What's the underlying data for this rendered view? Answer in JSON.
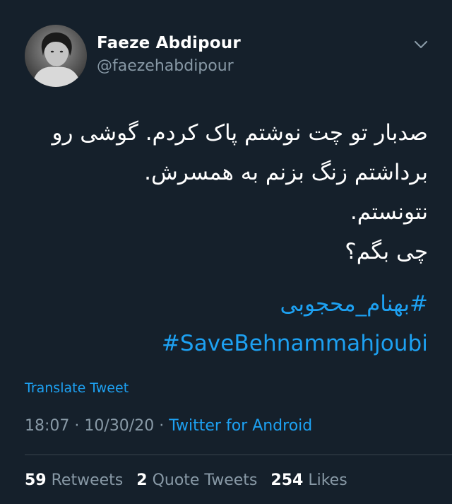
{
  "author": {
    "name": "Faeze Abdipour",
    "handle": "@faezehabdipour"
  },
  "tweet": {
    "lines": [
      "صدبار تو چت نوشتم پاک کردم. گوشی رو",
      "برداشتم زنگ بزنم به همسرش.",
      "نتونستم.",
      "چی بگم؟"
    ],
    "hashtags": [
      "#بهنام_محجوبی",
      "#SaveBehnammahjoubi"
    ]
  },
  "translate_label": "Translate Tweet",
  "meta": {
    "time": "18:07",
    "date": "10/30/20",
    "separator": "·",
    "source": "Twitter for Android"
  },
  "stats": {
    "retweets": {
      "count": "59",
      "label": "Retweets"
    },
    "quote_tweets": {
      "count": "2",
      "label": "Quote Tweets"
    },
    "likes": {
      "count": "254",
      "label": "Likes"
    }
  },
  "colors": {
    "background": "#15202b",
    "accent": "#1da1f2",
    "secondary_text": "#8899a6"
  },
  "icons": {
    "menu": "chevron-down-icon"
  }
}
